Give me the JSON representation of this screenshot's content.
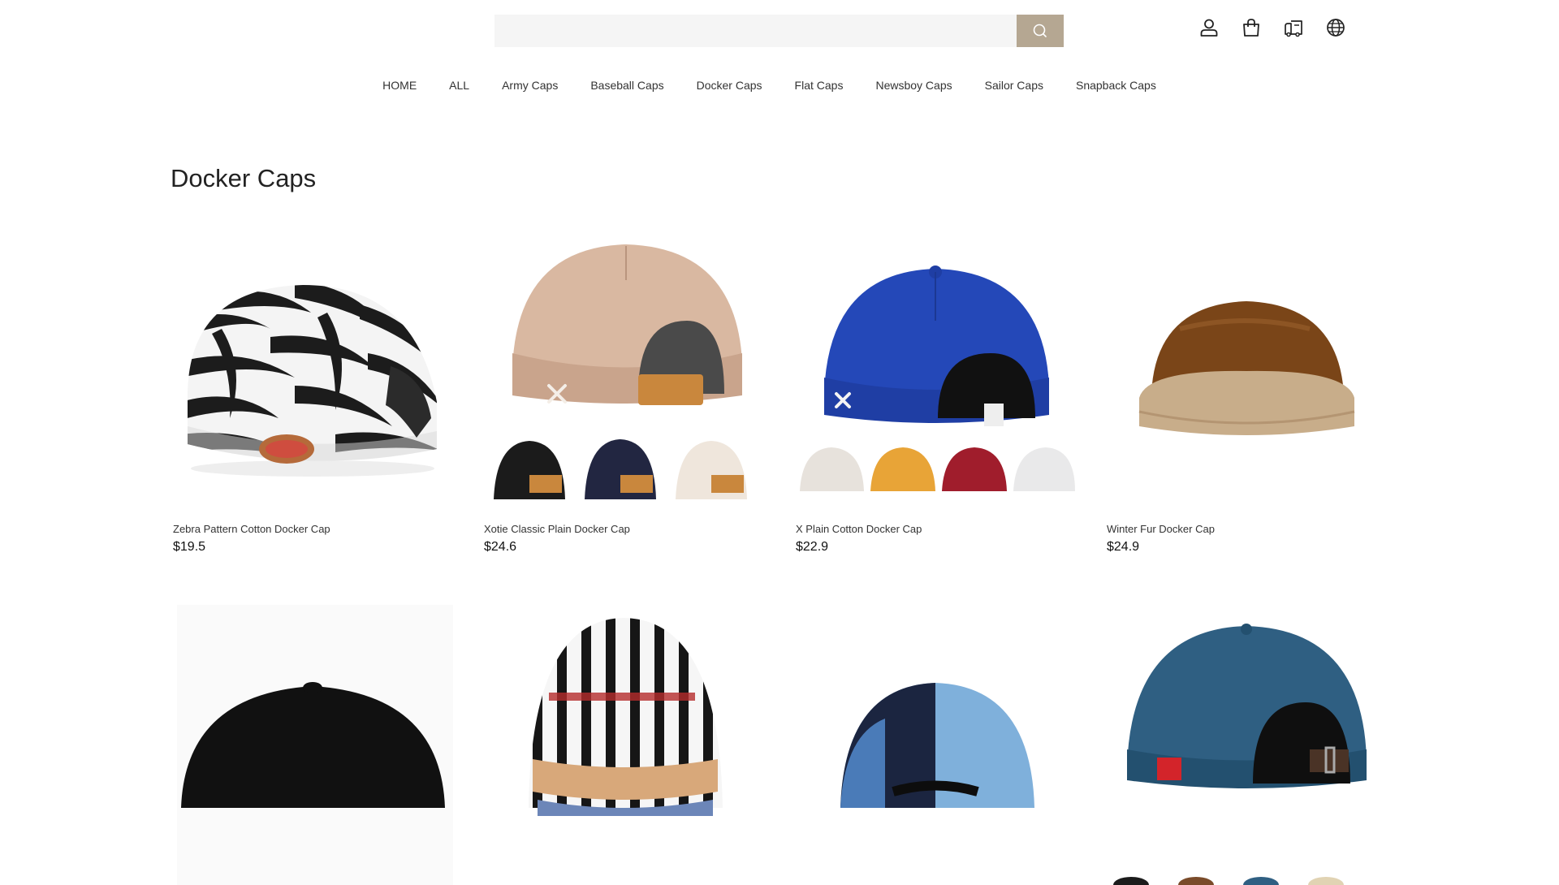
{
  "header": {
    "search": {
      "value": "",
      "placeholder": ""
    },
    "icons": [
      "user-icon",
      "shopping-bag-icon",
      "order-tracking-icon",
      "globe-icon"
    ]
  },
  "nav": {
    "items": [
      "HOME",
      "ALL",
      "Army Caps",
      "Baseball Caps",
      "Docker Caps",
      "Flat Caps",
      "Newsboy Caps",
      "Sailor Caps",
      "Snapback Caps"
    ]
  },
  "page": {
    "title": "Docker Caps"
  },
  "products": [
    {
      "name": "Zebra Pattern Cotton Docker Cap",
      "price": "$19.5"
    },
    {
      "name": "Xotie Classic Plain Docker Cap",
      "price": "$24.6"
    },
    {
      "name": "X Plain Cotton Docker Cap",
      "price": "$22.9"
    },
    {
      "name": "Winter Fur Docker Cap",
      "price": "$24.9"
    },
    {
      "name": "",
      "price": ""
    },
    {
      "name": "",
      "price": ""
    },
    {
      "name": "",
      "price": ""
    },
    {
      "name": "",
      "price": ""
    }
  ],
  "colors": {
    "search_button": "#b5a792",
    "search_field": "#f5f5f5"
  }
}
